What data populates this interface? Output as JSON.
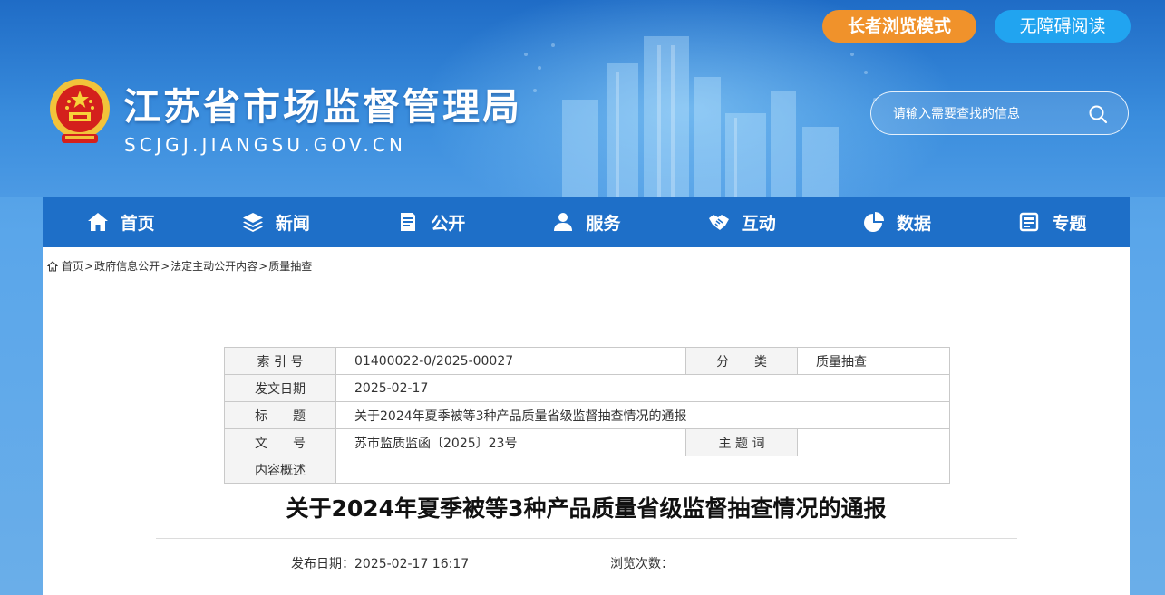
{
  "header": {
    "site_title": "江苏省市场监督管理局",
    "site_domain": "SCJGJ.JIANGSU.GOV.CN",
    "elder_mode_label": "长者浏览模式",
    "accessible_label": "无障碍阅读",
    "search_placeholder": "请输入需要查找的信息"
  },
  "nav": {
    "items": [
      {
        "label": "首页",
        "icon": "home-icon"
      },
      {
        "label": "新闻",
        "icon": "layers-icon"
      },
      {
        "label": "公开",
        "icon": "document-icon"
      },
      {
        "label": "服务",
        "icon": "people-icon"
      },
      {
        "label": "互动",
        "icon": "handshake-icon"
      },
      {
        "label": "数据",
        "icon": "pie-chart-icon"
      },
      {
        "label": "专题",
        "icon": "topic-icon"
      }
    ]
  },
  "breadcrumb": {
    "items": [
      "首页",
      "政府信息公开",
      "法定主动公开内容",
      "质量抽查"
    ],
    "separator": ">"
  },
  "meta": {
    "index_label": "索 引 号",
    "index_value": "01400022-0/2025-00027",
    "category_label": "分　　类",
    "category_value": "质量抽查",
    "date_label": "发文日期",
    "date_value": "2025-02-17",
    "title_label": "标　　题",
    "title_value": "关于2024年夏季被等3种产品质量省级监督抽查情况的通报",
    "docno_label": "文　　号",
    "docno_value": "苏市监质监函〔2025〕23号",
    "keywords_label": "主 题 词",
    "keywords_value": "",
    "summary_label": "内容概述",
    "summary_value": ""
  },
  "article": {
    "title": "关于2024年夏季被等3种产品质量省级监督抽查情况的通报",
    "publish_date": "发布日期：2025-02-17 16:17",
    "views": "浏览次数："
  },
  "colors": {
    "nav_bg": "#1e6fc8",
    "elder_btn": "#f0922b",
    "access_btn": "#21a4f0"
  }
}
